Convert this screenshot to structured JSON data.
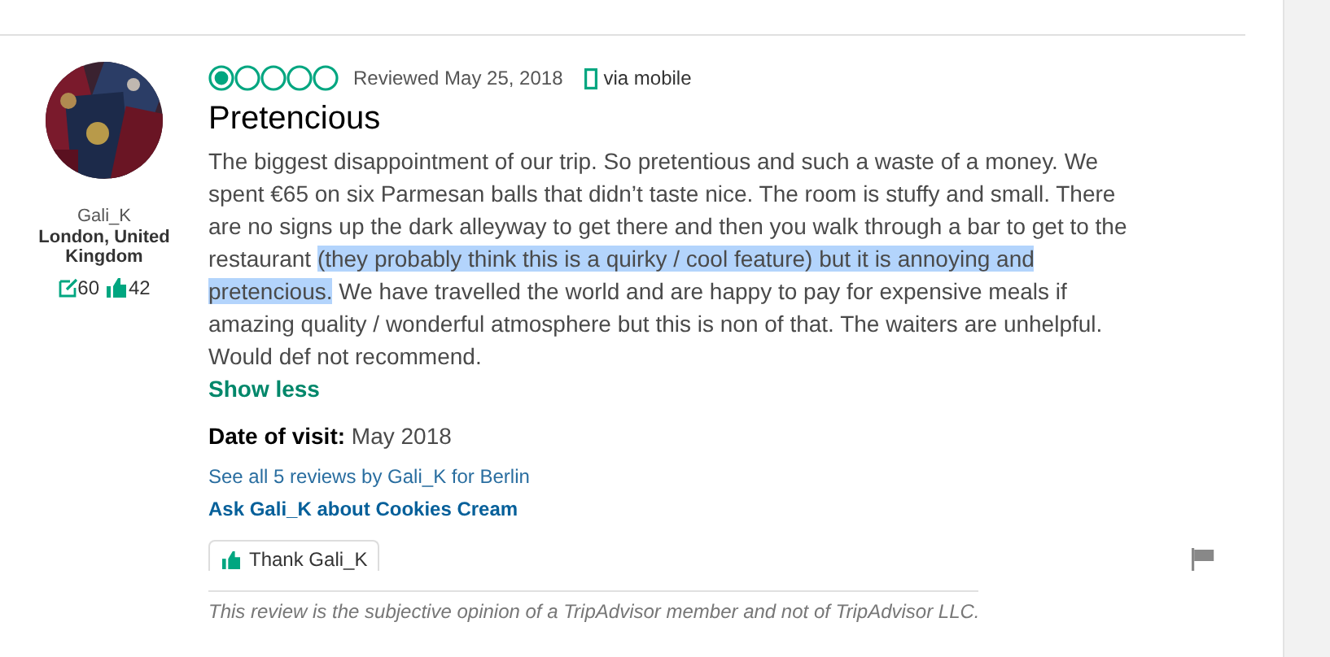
{
  "reviewer": {
    "username": "Gali_K",
    "location": "London, United Kingdom",
    "review_count": "60",
    "helpful_votes": "42"
  },
  "review": {
    "stars": 1,
    "reviewed_date": "Reviewed May 25, 2018",
    "via": "via mobile",
    "title": "Pretencious",
    "body": [
      {
        "text": "The biggest disappointment of our trip. So pretentious and such a waste of a money. We spent €65 on six Parmesan balls that didn’t taste nice. The room is stuffy and small. There are no signs up the dark alleyway to get there and then you walk through a bar to get to the restaurant ",
        "highlighted": false
      },
      {
        "text": "(they probably think this is a quirky / cool feature) but it is annoying and pretencious.",
        "highlighted": true
      },
      {
        "text": " We have travelled the world and are happy to pay for expensive meals if amazing quality / wonderful atmosphere but this is non of that. The waiters are unhelpful. Would def not recommend.",
        "highlighted": false
      }
    ],
    "show_less": "Show less",
    "date_of_visit_label": "Date of visit:",
    "date_of_visit": "May 2018",
    "see_all_link": "See all 5 reviews by Gali_K for Berlin",
    "ask_link": "Ask Gali_K about Cookies Cream",
    "thank_button": "Thank Gali_K",
    "disclaimer": "This review is the subjective opinion of a TripAdvisor member and not of TripAdvisor LLC."
  }
}
